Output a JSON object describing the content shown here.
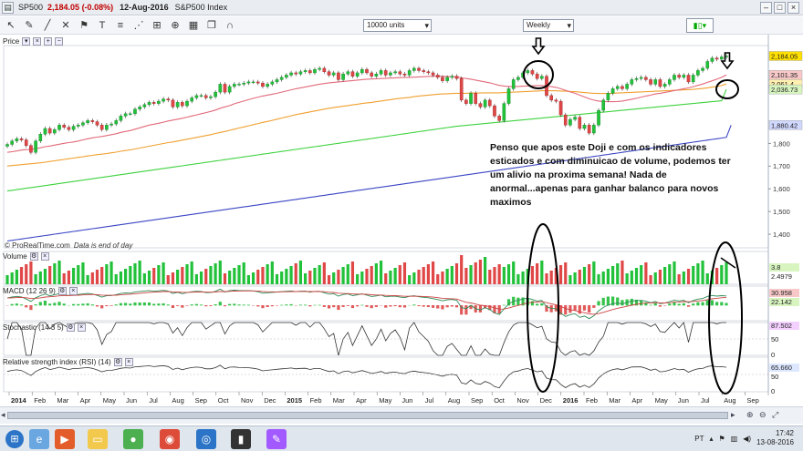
{
  "toolbar": {
    "symbol": "SP500",
    "price_change": "2,184.05 (-0.08%)",
    "date": "12-Aug-2016",
    "name": "S&P500 Index"
  },
  "controls": {
    "units": "10000 units",
    "period": "Weekly"
  },
  "panels": {
    "price": "Price",
    "volume": "Volume",
    "macd": "MACD (12 26 9)",
    "stochastic": "Stochastic (14 3 5)",
    "rsi": "Relative strength index (RSI) (14)"
  },
  "watermark": {
    "source": "© ProRealTime.com",
    "note": "Data is end of day"
  },
  "annotation": "Penso que apos este Doji e com os indicadores esticados e com diminuicao de volume, podemos ter um alivio na proxima semana! Nada de anormal...apenas para ganhar balanco para novos maximos",
  "price_axis": {
    "ticks": [
      "1,800",
      "1,700",
      "1,600",
      "1,500",
      "1,400"
    ],
    "labels": [
      {
        "text": "2,184.05",
        "color": "#ffe000",
        "value": 2184
      },
      {
        "text": "2,101.35",
        "color": "#f8c8c8",
        "value": 2101
      },
      {
        "text": "2,061.4",
        "color": "#fff0b0",
        "value": 2061
      },
      {
        "text": "2,036.73",
        "color": "#d8f5c0",
        "value": 2037
      },
      {
        "text": "1,880.42",
        "color": "#d0d8ff",
        "value": 1880
      }
    ]
  },
  "volume_axis": {
    "labels": [
      "2.4979",
      "3.8"
    ]
  },
  "macd_axis": {
    "labels": [
      "30.958",
      "22.142"
    ]
  },
  "stoch_axis": {
    "labels": [
      "87.502",
      "50",
      "0"
    ]
  },
  "rsi_axis": {
    "labels": [
      "65.660",
      "50",
      "0"
    ]
  },
  "time_axis": [
    "2014",
    "Feb",
    "Mar",
    "Apr",
    "May",
    "Jun",
    "Jul",
    "Aug",
    "Sep",
    "Oct",
    "Nov",
    "Dec",
    "2015",
    "Feb",
    "Mar",
    "Apr",
    "May",
    "Jun",
    "Jul",
    "Aug",
    "Sep",
    "Oct",
    "Nov",
    "Dec",
    "2016",
    "Feb",
    "Mar",
    "Apr",
    "May",
    "Jun",
    "Jul",
    "Aug",
    "Sep"
  ],
  "tray": {
    "lang": "PT",
    "time": "17:42",
    "date": "13-08-2016"
  },
  "chart_data": {
    "type": "candlestick",
    "frequency": "weekly",
    "ylim": [
      1340,
      2230
    ],
    "close": [
      1795,
      1810,
      1820,
      1815,
      1790,
      1760,
      1810,
      1840,
      1865,
      1845,
      1860,
      1880,
      1870,
      1860,
      1875,
      1880,
      1890,
      1900,
      1895,
      1880,
      1860,
      1880,
      1885,
      1900,
      1920,
      1930,
      1930,
      1950,
      1960,
      1970,
      1980,
      1975,
      1985,
      1995,
      1990,
      1960,
      1980,
      1965,
      1985,
      2000,
      2010,
      2010,
      2000,
      2005,
      2025,
      2060,
      2025,
      2050,
      2060,
      2060,
      2065,
      2070,
      2070,
      2065,
      2050,
      2060,
      2070,
      2080,
      2090,
      2100,
      2110,
      2105,
      2115,
      2120,
      2110,
      2125,
      2130,
      2115,
      2100,
      2110,
      2080,
      2105,
      2115,
      2095,
      2110,
      2125,
      2110,
      2095,
      2105,
      2120,
      2100,
      2110,
      2115,
      2105,
      2100,
      2120,
      2130,
      2120,
      2115,
      2110,
      2100,
      2090,
      2075,
      2090,
      2095,
      2085,
      1990,
      1975,
      2020,
      1975,
      1960,
      1990,
      1965,
      1920,
      1900,
      1975,
      2040,
      2080,
      2090,
      2110,
      2120,
      2105,
      2085,
      2095,
      2010,
      1990,
      1985,
      1925,
      1880,
      1905,
      1915,
      1865,
      1880,
      1845,
      1880,
      1945,
      1990,
      2020,
      2040,
      2050,
      2040,
      2060,
      2080,
      2085,
      2090,
      2080,
      2060,
      2080,
      2050,
      2060,
      2080,
      2100,
      2090,
      2100,
      2070,
      2100,
      2120,
      2130,
      2160,
      2175,
      2170,
      2180,
      2184
    ],
    "ma_red": [
      1760,
      1763,
      1766,
      1770,
      1772,
      1773,
      1776,
      1780,
      1785,
      1788,
      1792,
      1796,
      1800,
      1803,
      1806,
      1810,
      1815,
      1820,
      1824,
      1827,
      1830,
      1834,
      1838,
      1842,
      1848,
      1852,
      1856,
      1862,
      1868,
      1874,
      1880,
      1884,
      1888,
      1893,
      1898,
      1902,
      1906,
      1910,
      1915,
      1920,
      1925,
      1930,
      1935,
      1940,
      1946,
      1954,
      1960,
      1966,
      1974,
      1980,
      1986,
      1992,
      1998,
      2003,
      2008,
      2012,
      2016,
      2020,
      2025,
      2030,
      2035,
      2040,
      2044,
      2048,
      2052,
      2056,
      2060,
      2063,
      2066,
      2068,
      2070,
      2072,
      2074,
      2076,
      2078,
      2080,
      2082,
      2083,
      2084,
      2085,
      2086,
      2087,
      2088,
      2089,
      2090,
      2090,
      2091,
      2092,
      2093,
      2094,
      2095,
      2096,
      2095,
      2094,
      2093,
      2092,
      2088,
      2085,
      2082,
      2078,
      2074,
      2070,
      2066,
      2060,
      2055,
      2052,
      2050,
      2050,
      2050,
      2051,
      2052,
      2053,
      2054,
      2054,
      2052,
      2049,
      2046,
      2040,
      2033,
      2026,
      2020,
      2012,
      2004,
      1996,
      1990,
      1986,
      1984,
      1983,
      1983,
      1984,
      1986,
      1990,
      1994,
      1998,
      2003,
      2008,
      2012,
      2017,
      2020,
      2024,
      2028,
      2032,
      2036,
      2040,
      2044,
      2049,
      2055,
      2061,
      2068,
      2075,
      2082,
      2090,
      2101
    ],
    "ma_orange": [
      1700,
      1702,
      1704,
      1706,
      1708,
      1710,
      1712,
      1714,
      1717,
      1720,
      1723,
      1726,
      1729,
      1732,
      1735,
      1738,
      1741,
      1744,
      1747,
      1750,
      1752,
      1755,
      1758,
      1761,
      1765,
      1768,
      1771,
      1775,
      1779,
      1783,
      1787,
      1791,
      1795,
      1799,
      1803,
      1806,
      1810,
      1814,
      1818,
      1822,
      1826,
      1830,
      1834,
      1838,
      1843,
      1848,
      1852,
      1857,
      1862,
      1867,
      1872,
      1877,
      1882,
      1887,
      1892,
      1896,
      1901,
      1906,
      1911,
      1916,
      1921,
      1926,
      1930,
      1934,
      1938,
      1942,
      1946,
      1950,
      1954,
      1957,
      1960,
      1963,
      1966,
      1969,
      1972,
      1975,
      1978,
      1980,
      1983,
      1986,
      1989,
      1992,
      1995,
      1998,
      2000,
      2002,
      2005,
      2008,
      2010,
      2012,
      2014,
      2016,
      2017,
      2018,
      2019,
      2020,
      2020,
      2020,
      2021,
      2021,
      2021,
      2022,
      2022,
      2022,
      2022,
      2023,
      2024,
      2025,
      2026,
      2027,
      2028,
      2029,
      2030,
      2031,
      2031,
      2031,
      2031,
      2030,
      2029,
      2028,
      2027,
      2025,
      2023,
      2021,
      2020,
      2019,
      2019,
      2019,
      2020,
      2021,
      2022,
      2023,
      2024,
      2025,
      2026,
      2027,
      2028,
      2029,
      2030,
      2031,
      2032,
      2033,
      2034,
      2035,
      2036,
      2037,
      2039,
      2041,
      2044,
      2047,
      2050,
      2054,
      2061
    ],
    "ma_green": [
      1590,
      1593,
      1596,
      1599,
      1602,
      1605,
      1608,
      1611,
      1614,
      1617,
      1620,
      1623,
      1626,
      1629,
      1632,
      1635,
      1638,
      1641,
      1644,
      1647,
      1650,
      1653,
      1656,
      1659,
      1662,
      1665,
      1668,
      1671,
      1674,
      1677,
      1680,
      1683,
      1686,
      1689,
      1692,
      1695,
      1698,
      1701,
      1704,
      1707,
      1710,
      1713,
      1716,
      1719,
      1722,
      1725,
      1728,
      1731,
      1734,
      1737,
      1740,
      1743,
      1746,
      1749,
      1752,
      1755,
      1758,
      1761,
      1764,
      1767,
      1770,
      1773,
      1776,
      1779,
      1782,
      1785,
      1788,
      1791,
      1794,
      1797,
      1800,
      1803,
      1806,
      1809,
      1812,
      1815,
      1818,
      1821,
      1824,
      1827,
      1830,
      1833,
      1836,
      1839,
      1842,
      1845,
      1848,
      1851,
      1854,
      1857,
      1860,
      1863,
      1866,
      1869,
      1872,
      1875,
      1877,
      1879,
      1881,
      1883,
      1885,
      1887,
      1889,
      1891,
      1893,
      1895,
      1897,
      1899,
      1901,
      1903,
      1905,
      1907,
      1909,
      1911,
      1913,
      1915,
      1917,
      1919,
      1921,
      1923,
      1925,
      1927,
      1929,
      1931,
      1933,
      1935,
      1937,
      1939,
      1941,
      1943,
      1945,
      1947,
      1949,
      1951,
      1953,
      1955,
      1957,
      1959,
      1961,
      1963,
      1965,
      1967,
      1969,
      1971,
      1973,
      1975,
      1977,
      1979,
      1981,
      1983,
      1985,
      1987,
      2037
    ],
    "ma_blue": [
      1370,
      1373,
      1376,
      1379,
      1382,
      1385,
      1388,
      1391,
      1394,
      1397,
      1400,
      1403,
      1406,
      1409,
      1412,
      1415,
      1418,
      1421,
      1424,
      1427,
      1430,
      1433,
      1436,
      1439,
      1442,
      1445,
      1448,
      1451,
      1454,
      1457,
      1460,
      1463,
      1466,
      1469,
      1472,
      1475,
      1478,
      1481,
      1484,
      1487,
      1490,
      1493,
      1496,
      1499,
      1502,
      1505,
      1508,
      1511,
      1514,
      1517,
      1520,
      1523,
      1526,
      1529,
      1532,
      1535,
      1538,
      1541,
      1544,
      1547,
      1550,
      1553,
      1556,
      1559,
      1562,
      1565,
      1568,
      1571,
      1574,
      1577,
      1580,
      1583,
      1586,
      1589,
      1592,
      1595,
      1598,
      1601,
      1604,
      1607,
      1610,
      1613,
      1616,
      1619,
      1622,
      1625,
      1628,
      1631,
      1634,
      1637,
      1640,
      1643,
      1646,
      1649,
      1652,
      1655,
      1658,
      1661,
      1664,
      1667,
      1670,
      1673,
      1676,
      1679,
      1682,
      1685,
      1688,
      1691,
      1694,
      1697,
      1700,
      1703,
      1706,
      1709,
      1712,
      1715,
      1718,
      1721,
      1724,
      1727,
      1730,
      1733,
      1736,
      1739,
      1742,
      1745,
      1748,
      1751,
      1754,
      1757,
      1760,
      1763,
      1766,
      1769,
      1772,
      1775,
      1778,
      1781,
      1784,
      1787,
      1790,
      1793,
      1796,
      1799,
      1802,
      1805,
      1808,
      1811,
      1814,
      1817,
      1820,
      1823,
      1826,
      1880
    ]
  }
}
